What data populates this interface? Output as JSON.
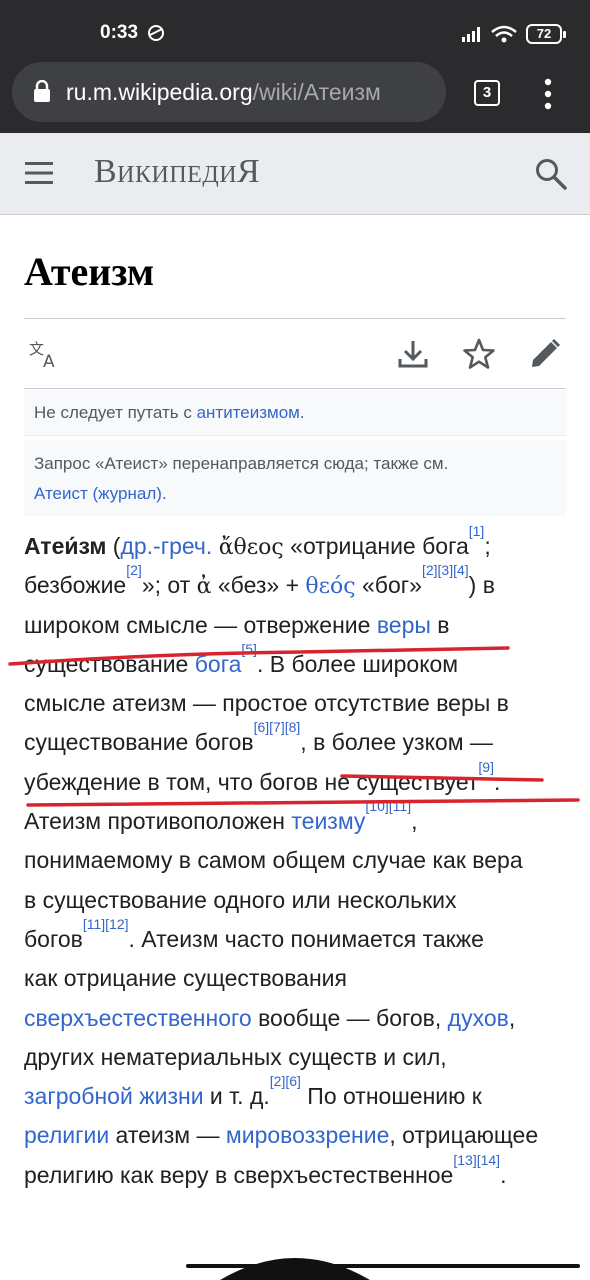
{
  "status": {
    "time": "0:33",
    "battery": "72"
  },
  "browser": {
    "url_host": "ru.m.wikipedia.org",
    "url_path": "/wiki/Атеизм",
    "tabs_count": "3"
  },
  "header": {
    "logo": "ВикипедиЯ"
  },
  "page": {
    "title": "Атеизм",
    "hatnote1": {
      "prefix": "Не следует путать с ",
      "link": "антитеизмом",
      "suffix": "."
    },
    "hatnote2": {
      "text": "Запрос «Атеист» перенаправляется сюда; также см.",
      "link": "Атеист (журнал)",
      "suffix": "."
    }
  },
  "article": {
    "l1": {
      "bold": "Атеи́зм",
      "t1": " (",
      "link1": "др.-греч.",
      "t2": " ",
      "greek": "ἄθεος",
      "t3": " «отрицание бога",
      "ref1": "[1]",
      "t4": ";"
    },
    "l2": {
      "t1": "безбожие",
      "ref1": "[2]",
      "t2": "»; от ",
      "greek1": "ἀ",
      "t3": " «без» + ",
      "greek2": "θεός",
      "t4": " «бог»",
      "ref2": "[2][3][4]",
      "t5": ") в"
    },
    "l3": {
      "t1": "широком смысле — отвержение ",
      "link1": "веры",
      "t2": " в"
    },
    "l4": {
      "t1": "существование ",
      "link1": "бога",
      "ref1": "[5]",
      "t2": ". В более широком"
    },
    "l5": {
      "t1": "смысле атеизм — простое отсутствие веры в"
    },
    "l6": {
      "t1": "существование богов",
      "ref1": "[6][7][8]",
      "t2": ", в более узком —"
    },
    "l7": {
      "t1": "убеждение в том, что богов не существует",
      "ref1": "[9]",
      "t2": "."
    },
    "l8": {
      "t1": "Атеизм противоположен ",
      "link1": "теизму",
      "ref1": "[10][11]",
      "t2": ","
    },
    "l9": {
      "t1": "понимаемому в самом общем случае как вера"
    },
    "l10": {
      "t1": "в существование одного или нескольких"
    },
    "l11": {
      "t1": "богов",
      "ref1": "[11][12]",
      "t2": ". Атеизм часто понимается также"
    },
    "l12": {
      "t1": "как отрицание существования"
    },
    "l13": {
      "link1": "сверхъестественного",
      "t1": " вообще — богов, ",
      "link2": "духов",
      "t2": ","
    },
    "l14": {
      "t1": "других нематериальных существ и сил,"
    },
    "l15": {
      "link1": "загробной жизни",
      "t1": " и т. д.",
      "ref1": "[2][6]",
      "t2": " По отношению к"
    },
    "l16": {
      "link1": "религии",
      "t1": " атеизм — ",
      "link2": "мировоззрение",
      "t2": ", отрицающее"
    },
    "l17": {
      "t1": "религию как веру в сверхъестественное",
      "ref1": "[13][14]",
      "t2": "."
    }
  },
  "colors": {
    "link": "#3366cc",
    "annotation": "#d9232e",
    "chrome": "#2b2b2d",
    "header": "#eaecf0"
  },
  "icons": [
    "lock-icon",
    "hamburger-icon",
    "search-icon",
    "language-icon",
    "download-icon",
    "star-icon",
    "edit-icon",
    "tabs-icon",
    "overflow-menu-icon"
  ]
}
